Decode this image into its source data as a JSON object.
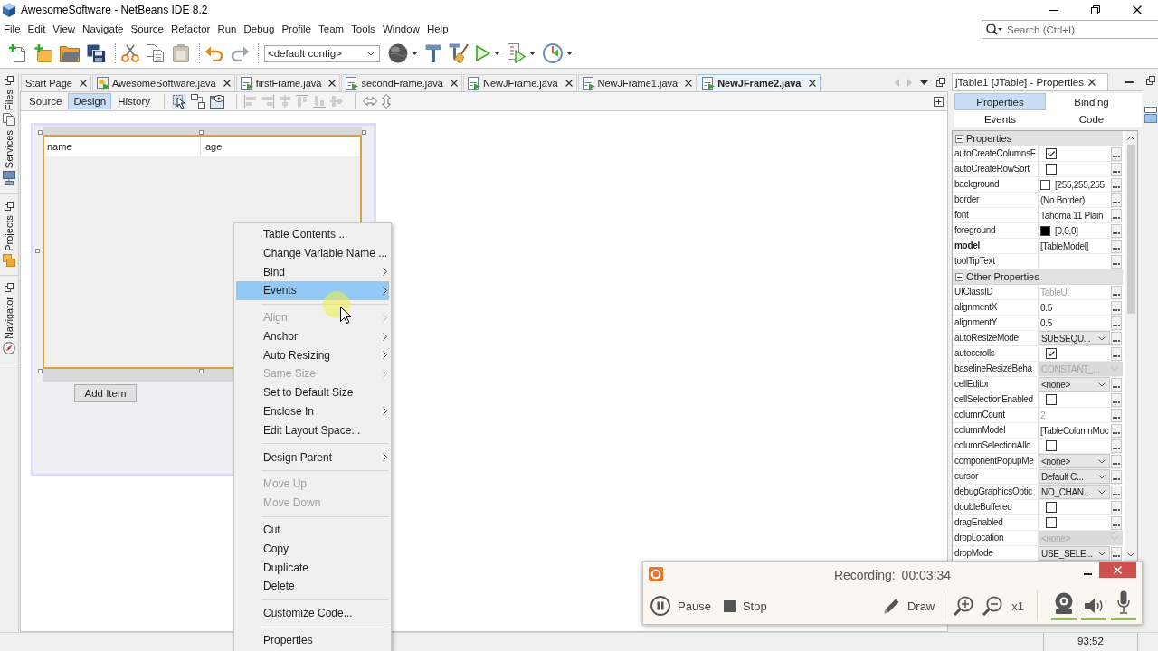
{
  "window": {
    "title": "AwesomeSoftware - NetBeans IDE 8.2"
  },
  "menu_bar": [
    "File",
    "Edit",
    "View",
    "Navigate",
    "Source",
    "Refactor",
    "Run",
    "Debug",
    "Profile",
    "Team",
    "Tools",
    "Window",
    "Help"
  ],
  "search": {
    "placeholder": "Search (Ctrl+I)"
  },
  "toolbar": {
    "config": "<default config>"
  },
  "side_groups": [
    [
      {
        "label": "Files",
        "kind": "files"
      },
      {
        "label": "Services",
        "kind": "services"
      }
    ],
    [
      {
        "label": "Projects",
        "kind": "projects"
      }
    ],
    [
      {
        "label": "Navigator",
        "kind": "navigator"
      }
    ]
  ],
  "editor": {
    "tabs": [
      {
        "label": "Start Page",
        "kind": "page",
        "selected": false
      },
      {
        "label": "AwesomeSoftware.java",
        "kind": "main",
        "selected": false
      },
      {
        "label": "firstFrame.java",
        "kind": "form",
        "selected": false
      },
      {
        "label": "secondFrame.java",
        "kind": "form",
        "selected": false
      },
      {
        "label": "NewJFrame.java",
        "kind": "form",
        "selected": false
      },
      {
        "label": "NewJFrame1.java",
        "kind": "form",
        "selected": false
      },
      {
        "label": "NewJFrame2.java",
        "kind": "form",
        "selected": true
      }
    ],
    "views": [
      {
        "label": "Source",
        "selected": false
      },
      {
        "label": "Design",
        "selected": true
      },
      {
        "label": "History",
        "selected": false
      }
    ]
  },
  "form": {
    "table": {
      "columns": [
        "name",
        "age"
      ]
    },
    "button": "Add Item"
  },
  "context_menu": {
    "groups": [
      [
        {
          "label": "Table Contents ...",
          "submenu": false,
          "disabled": false,
          "selected": false
        },
        {
          "label": "Change Variable Name ...",
          "submenu": false,
          "disabled": false,
          "selected": false
        },
        {
          "label": "Bind",
          "submenu": true,
          "disabled": false,
          "selected": false
        },
        {
          "label": "Events",
          "submenu": true,
          "disabled": false,
          "selected": true
        }
      ],
      [
        {
          "label": "Align",
          "submenu": true,
          "disabled": true,
          "selected": false
        },
        {
          "label": "Anchor",
          "submenu": true,
          "disabled": false,
          "selected": false
        },
        {
          "label": "Auto Resizing",
          "submenu": true,
          "disabled": false,
          "selected": false
        },
        {
          "label": "Same Size",
          "submenu": true,
          "disabled": true,
          "selected": false
        },
        {
          "label": "Set to Default Size",
          "submenu": false,
          "disabled": false,
          "selected": false
        },
        {
          "label": "Enclose In",
          "submenu": true,
          "disabled": false,
          "selected": false
        },
        {
          "label": "Edit Layout Space...",
          "submenu": false,
          "disabled": false,
          "selected": false
        }
      ],
      [
        {
          "label": "Design Parent",
          "submenu": true,
          "disabled": false,
          "selected": false
        }
      ],
      [
        {
          "label": "Move Up",
          "submenu": false,
          "disabled": true,
          "selected": false
        },
        {
          "label": "Move Down",
          "submenu": false,
          "disabled": true,
          "selected": false
        }
      ],
      [
        {
          "label": "Cut",
          "submenu": false,
          "disabled": false,
          "selected": false
        },
        {
          "label": "Copy",
          "submenu": false,
          "disabled": false,
          "selected": false
        },
        {
          "label": "Duplicate",
          "submenu": false,
          "disabled": false,
          "selected": false
        },
        {
          "label": "Delete",
          "submenu": false,
          "disabled": false,
          "selected": false
        }
      ],
      [
        {
          "label": "Customize Code...",
          "submenu": false,
          "disabled": false,
          "selected": false
        }
      ],
      [
        {
          "label": "Properties",
          "submenu": false,
          "disabled": false,
          "selected": false
        }
      ]
    ]
  },
  "properties": {
    "title": "jTable1 [JTable] - Properties",
    "tabs": [
      {
        "label": "Properties",
        "selected": true
      },
      {
        "label": "Binding",
        "selected": false
      },
      {
        "label": "Events",
        "selected": false
      },
      {
        "label": "Code",
        "selected": false
      }
    ],
    "sections": [
      {
        "title": "Properties",
        "expanded": true,
        "rows": [
          {
            "name": "autoCreateColumnsF",
            "kind": "checkbox",
            "checked": true,
            "modified": false
          },
          {
            "name": "autoCreateRowSort",
            "kind": "checkbox",
            "checked": false,
            "modified": false
          },
          {
            "name": "background",
            "kind": "color",
            "color": "#ffffff",
            "value": "[255,255,255",
            "modified": false
          },
          {
            "name": "border",
            "kind": "text",
            "value": "(No Border)",
            "modified": false
          },
          {
            "name": "font",
            "kind": "text",
            "value": "Tahoma 11 Plain",
            "modified": false
          },
          {
            "name": "foreground",
            "kind": "color",
            "color": "#000000",
            "value": "[0,0,0]",
            "modified": false
          },
          {
            "name": "model",
            "kind": "text",
            "value": "[TableModel]",
            "modified": true
          },
          {
            "name": "toolTipText",
            "kind": "text",
            "modified": false
          }
        ]
      },
      {
        "title": "Other Properties",
        "expanded": true,
        "rows": [
          {
            "name": "UIClassID",
            "kind": "read_only_text",
            "value": "TableUI",
            "modified": false
          },
          {
            "name": "alignmentX",
            "kind": "text",
            "value": "0.5",
            "modified": false
          },
          {
            "name": "alignmentY",
            "kind": "text",
            "value": "0.5",
            "modified": false
          },
          {
            "name": "autoResizeMode",
            "kind": "combo",
            "value": "SUBSEQU...",
            "modified": false
          },
          {
            "name": "autoscrolls",
            "kind": "checkbox",
            "checked": true,
            "modified": false
          },
          {
            "name": "baselineResizeBeha",
            "kind": "read_only_combo",
            "value": "CONSTANT_...",
            "modified": false
          },
          {
            "name": "cellEditor",
            "kind": "combo",
            "value": "<none>",
            "modified": false
          },
          {
            "name": "cellSelectionEnabled",
            "kind": "checkbox",
            "checked": false,
            "modified": false
          },
          {
            "name": "columnCount",
            "kind": "read_only_text",
            "value": "2",
            "modified": false
          },
          {
            "name": "columnModel",
            "kind": "text",
            "value": "[TableColumnMoc",
            "modified": false
          },
          {
            "name": "columnSelectionAllo",
            "kind": "checkbox",
            "checked": false,
            "modified": false
          },
          {
            "name": "componentPopupMe",
            "kind": "combo",
            "value": "<none>",
            "modified": false
          },
          {
            "name": "cursor",
            "kind": "combo",
            "value": "Default C...",
            "modified": false
          },
          {
            "name": "debugGraphicsOptic",
            "kind": "combo",
            "value": "NO_CHAN...",
            "modified": false
          },
          {
            "name": "doubleBuffered",
            "kind": "checkbox",
            "checked": false,
            "modified": false
          },
          {
            "name": "dragEnabled",
            "kind": "checkbox",
            "checked": false,
            "modified": false
          },
          {
            "name": "dropLocation",
            "kind": "read_only_combo",
            "value": "<none>",
            "modified": false
          },
          {
            "name": "dropMode",
            "kind": "combo",
            "value": "USE_SELE...",
            "modified": false
          }
        ]
      }
    ]
  },
  "recorder": {
    "status": "Recording:",
    "time": "00:03:34",
    "controls": [
      {
        "kind": "pause",
        "label": "Pause"
      },
      {
        "kind": "stop",
        "label": "Stop"
      },
      {
        "kind": "draw",
        "label": "Draw"
      }
    ],
    "zoom": "x1",
    "sources": [
      {
        "kind": "webcam",
        "on": true
      },
      {
        "kind": "speaker",
        "on": true
      },
      {
        "kind": "microphone",
        "on": true
      }
    ]
  },
  "status_bar": {
    "position": "93:52"
  }
}
